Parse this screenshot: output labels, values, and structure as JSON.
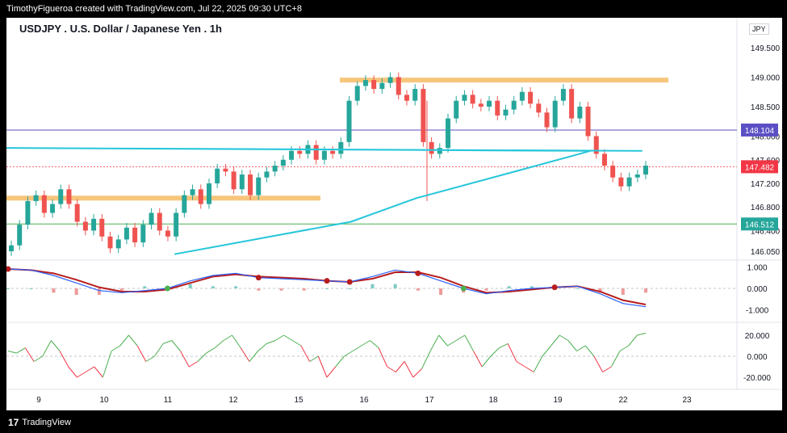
{
  "header": {
    "credit": "TimothyFigueroa created with TradingView.com, Jul 22, 2025 09:30 UTC+8"
  },
  "chart": {
    "title": "USDJPY . U.S. Dollar / Japanese Yen . 1h",
    "currency": "JPY",
    "price_ticks": [
      "149.500",
      "149.000",
      "148.500",
      "148.000",
      "147.600",
      "147.200",
      "146.800",
      "146.400",
      "146.050"
    ],
    "price_labels": [
      {
        "text": "148.104",
        "color": "#5b4fc4"
      },
      {
        "text": "147.482",
        "color": "#f23645"
      },
      {
        "text": "146.512",
        "color": "#26a69a"
      }
    ],
    "x_ticks": [
      "9",
      "10",
      "11",
      "12",
      "15",
      "16",
      "17",
      "18",
      "19",
      "22",
      "23"
    ],
    "macd_ticks": [
      "1.000",
      "0.000",
      "-1.000"
    ],
    "osc_ticks": [
      "20.000",
      "0.000",
      "-20.000"
    ]
  },
  "chart_data": {
    "type": "candlestick",
    "symbol": "USDJPY",
    "interval": "1h",
    "title": "USDJPY . U.S. Dollar / Japanese Yen . 1h",
    "x_tick_labels": [
      "9",
      "10",
      "11",
      "12",
      "15",
      "16",
      "17",
      "18",
      "19",
      "22",
      "23"
    ],
    "price_range": [
      145.9,
      149.8
    ],
    "horizontal_lines": [
      {
        "value": 148.104,
        "color": "#5b4fc4"
      },
      {
        "value": 146.512,
        "color": "#4caf50"
      },
      {
        "value": 147.482,
        "color": "#f23645",
        "style": "dotted"
      }
    ],
    "resistance_zones": [
      {
        "from": "16",
        "to": "22",
        "price": 148.95,
        "color": "#f7c57c"
      },
      {
        "from": "8",
        "to": "15",
        "price": 146.95,
        "color": "#f7c57c"
      }
    ],
    "moving_average": {
      "color": "#26c6da",
      "points": [
        [
          11.1,
          146.0
        ],
        [
          15.8,
          146.55
        ],
        [
          16.8,
          146.95
        ],
        [
          18.5,
          147.45
        ],
        [
          19.5,
          147.75
        ],
        [
          21.9,
          147.8
        ],
        [
          22.3,
          147.75
        ]
      ]
    },
    "close_series": [
      146.15,
      146.5,
      146.9,
      147.0,
      146.7,
      146.85,
      147.1,
      146.85,
      146.55,
      146.4,
      146.6,
      146.3,
      146.1,
      146.25,
      146.45,
      146.2,
      146.5,
      146.7,
      146.4,
      146.3,
      146.7,
      147.0,
      147.1,
      146.85,
      147.2,
      147.45,
      147.4,
      147.1,
      147.35,
      147.0,
      147.3,
      147.4,
      147.5,
      147.6,
      147.75,
      147.7,
      147.85,
      147.6,
      147.75,
      147.7,
      147.9,
      148.6,
      148.85,
      148.95,
      148.8,
      148.9,
      149.0,
      148.7,
      148.6,
      148.8,
      147.9,
      147.7,
      147.8,
      148.3,
      148.6,
      148.7,
      148.55,
      148.5,
      148.6,
      148.35,
      148.45,
      148.6,
      148.75,
      148.55,
      148.4,
      148.15,
      148.6,
      148.8,
      148.3,
      148.5,
      148.0,
      147.7,
      147.5,
      147.3,
      147.15,
      147.3,
      147.35,
      147.5
    ],
    "macd_range": [
      -1.5,
      1.2
    ],
    "macd": {
      "macd_line": [
        0.9,
        0.85,
        0.6,
        0.25,
        -0.1,
        -0.2,
        -0.1,
        0.0,
        0.35,
        0.6,
        0.7,
        0.5,
        0.45,
        0.4,
        0.35,
        0.3,
        0.55,
        0.85,
        0.7,
        0.35,
        0.0,
        -0.25,
        -0.1,
        0.0,
        0.05,
        0.1,
        -0.25,
        -0.7,
        -0.85
      ],
      "signal_line": [
        0.9,
        0.85,
        0.7,
        0.4,
        0.05,
        -0.15,
        -0.15,
        -0.05,
        0.25,
        0.55,
        0.65,
        0.55,
        0.5,
        0.45,
        0.35,
        0.3,
        0.45,
        0.75,
        0.75,
        0.5,
        0.1,
        -0.2,
        -0.15,
        -0.05,
        0.05,
        0.1,
        -0.15,
        -0.55,
        -0.75
      ]
    },
    "osc_range": [
      -30,
      30
    ],
    "oscillator_sample": [
      5,
      3,
      8,
      -5,
      0,
      15,
      5,
      -10,
      -20,
      -15,
      -10,
      -20,
      5,
      10,
      20,
      10,
      -5,
      0,
      12,
      15,
      5,
      -10,
      -5,
      3,
      8,
      15,
      20,
      8,
      -5,
      5,
      12,
      15,
      20,
      15,
      10,
      -5,
      0,
      -20,
      -10,
      0,
      5,
      10,
      15,
      8,
      -10,
      -15,
      -5,
      -20,
      -12,
      5,
      20,
      10,
      15,
      20,
      5,
      -10,
      0,
      8,
      12,
      -5,
      -10,
      -15,
      0,
      10,
      20,
      15,
      5,
      10,
      0,
      -15,
      -10,
      5,
      10,
      20,
      22
    ]
  }
}
